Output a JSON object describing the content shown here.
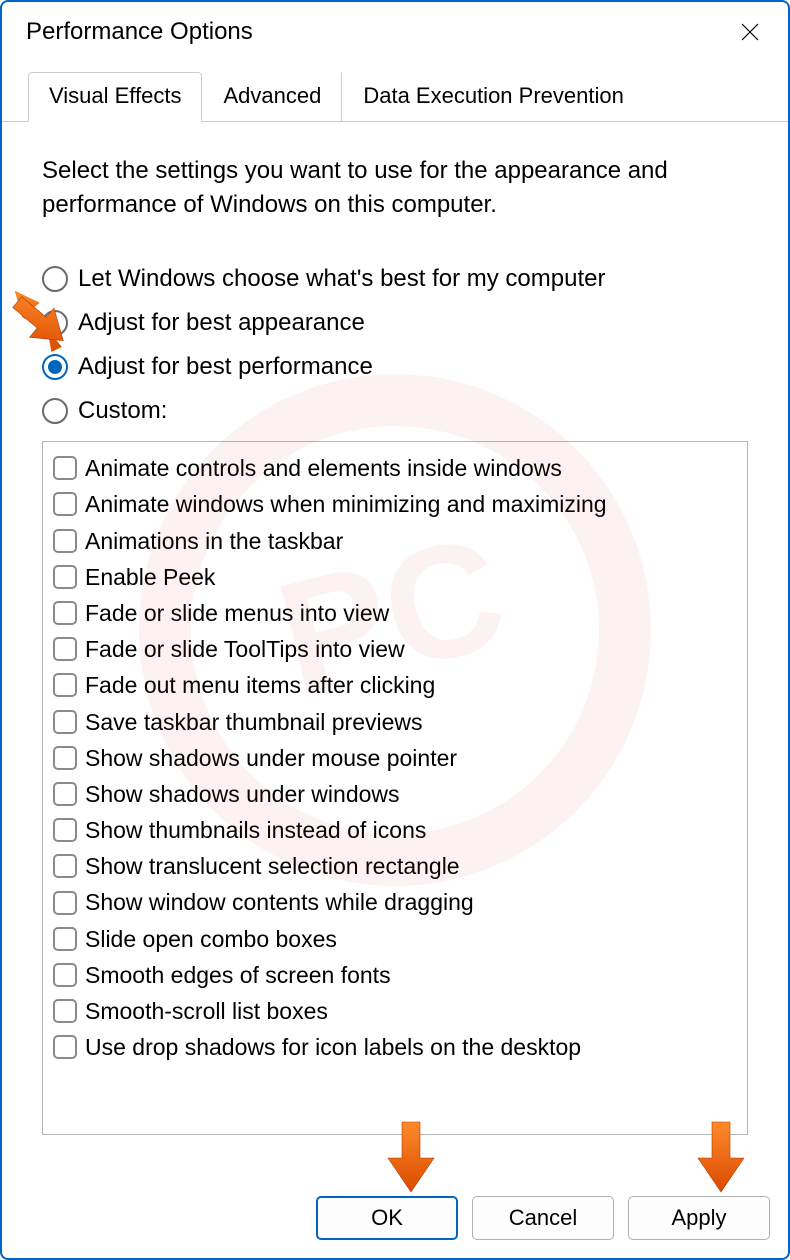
{
  "window": {
    "title": "Performance Options"
  },
  "tabs": [
    {
      "label": "Visual Effects",
      "active": true
    },
    {
      "label": "Advanced",
      "active": false
    },
    {
      "label": "Data Execution Prevention",
      "active": false
    }
  ],
  "intro": "Select the settings you want to use for the appearance and performance of Windows on this computer.",
  "radios": [
    {
      "label": "Let Windows choose what's best for my computer",
      "selected": false
    },
    {
      "label": "Adjust for best appearance",
      "selected": false
    },
    {
      "label": "Adjust for best performance",
      "selected": true
    },
    {
      "label": "Custom:",
      "selected": false
    }
  ],
  "options": [
    "Animate controls and elements inside windows",
    "Animate windows when minimizing and maximizing",
    "Animations in the taskbar",
    "Enable Peek",
    "Fade or slide menus into view",
    "Fade or slide ToolTips into view",
    "Fade out menu items after clicking",
    "Save taskbar thumbnail previews",
    "Show shadows under mouse pointer",
    "Show shadows under windows",
    "Show thumbnails instead of icons",
    "Show translucent selection rectangle",
    "Show window contents while dragging",
    "Slide open combo boxes",
    "Smooth edges of screen fonts",
    "Smooth-scroll list boxes",
    "Use drop shadows for icon labels on the desktop"
  ],
  "buttons": {
    "ok": "OK",
    "cancel": "Cancel",
    "apply": "Apply"
  }
}
